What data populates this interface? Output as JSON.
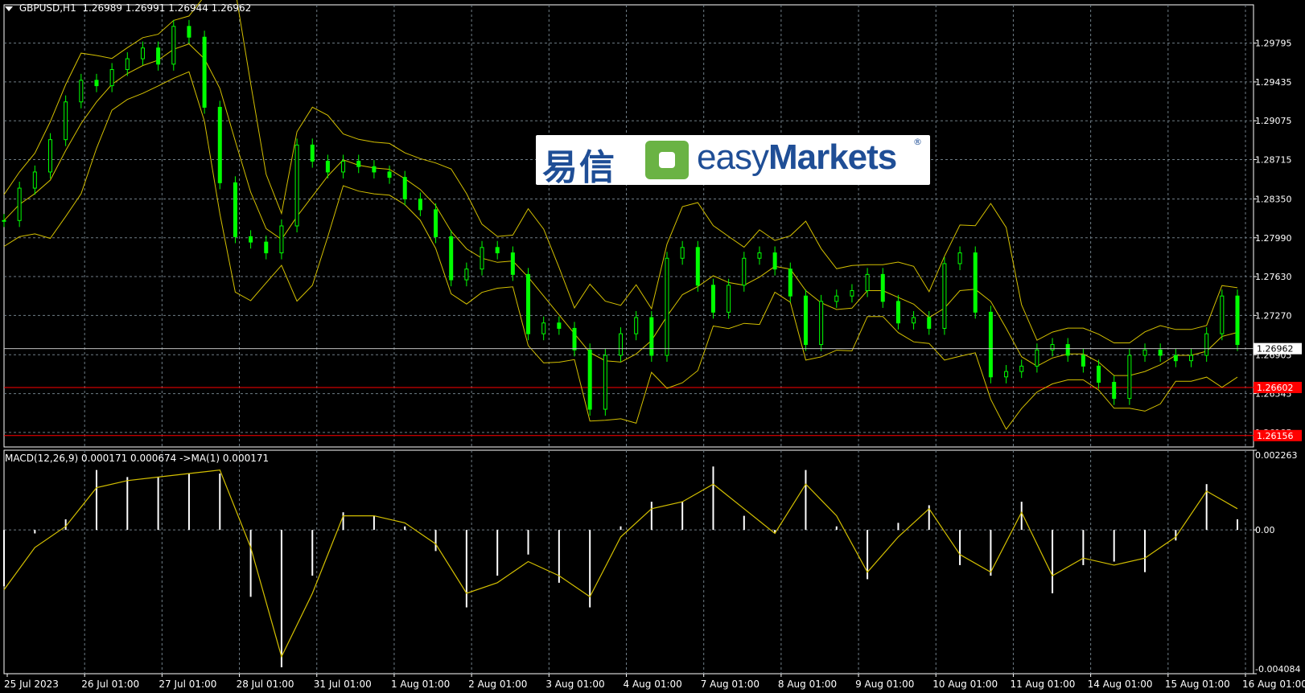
{
  "header": {
    "symbol": "GBPUSD,H1",
    "ohlc": "1.26989 1.26991 1.26944 1.26962",
    "macd_label": "MACD(12,26,9) 0.000171 0.000674  ->MA(1) 0.000171"
  },
  "logo": {
    "chinese": "易信",
    "brand_light": "easy",
    "brand_bold": "Markets",
    "reg": "®"
  },
  "colors": {
    "background": "#000000",
    "candles": "#00ff00",
    "bands": "#d4c000",
    "grid": "#6f7d86",
    "level": "#ff0000",
    "histogram": "#ffffff",
    "signal": "#d4c000"
  },
  "chart_data": [
    {
      "type": "line",
      "panel": "price",
      "instrument": "GBPUSD",
      "timeframe": "H1",
      "ylim": [
        1.2605,
        1.3015
      ],
      "yticks": [
        1.29795,
        1.29435,
        1.29075,
        1.28715,
        1.2835,
        1.2799,
        1.2763,
        1.2727,
        1.26905,
        1.26545,
        1.26185
      ],
      "ytick_labels": [
        "1.29795",
        "1.29435",
        "1.29075",
        "1.28715",
        "1.28350",
        "1.27990",
        "1.27630",
        "1.27270",
        "1.26905",
        "1.26545",
        "1.26185"
      ],
      "current_price": {
        "value": 1.26962,
        "label": "1.26962"
      },
      "levels": [
        {
          "value": 1.26602,
          "label": "1.26602",
          "color": "#ff0000"
        },
        {
          "value": 1.26156,
          "label": "1.26156",
          "color": "#ff0000"
        }
      ],
      "x_labels": [
        "25 Jul 2023",
        "26 Jul 01:00",
        "27 Jul 01:00",
        "28 Jul 01:00",
        "31 Jul 01:00",
        "1 Aug 01:00",
        "2 Aug 01:00",
        "3 Aug 01:00",
        "4 Aug 01:00",
        "7 Aug 01:00",
        "8 Aug 01:00",
        "9 Aug 01:00",
        "10 Aug 01:00",
        "11 Aug 01:00",
        "14 Aug 01:00",
        "15 Aug 01:00",
        "16 Aug 01:00"
      ],
      "x": [
        0,
        5,
        10,
        15,
        20,
        25,
        30,
        35,
        40,
        45,
        50,
        55,
        60,
        65,
        70,
        75,
        80,
        85,
        90,
        95,
        100,
        105,
        110,
        115,
        120,
        125,
        130,
        135,
        140,
        145,
        150,
        155,
        160,
        165,
        170,
        175,
        180,
        185,
        190,
        195,
        200,
        205,
        210,
        215,
        220,
        225,
        230,
        235,
        240,
        245,
        250,
        255,
        260,
        265,
        270,
        275,
        280,
        285,
        290,
        295,
        300,
        305,
        310,
        315,
        320,
        325,
        330,
        335,
        340,
        345,
        350,
        355,
        360,
        365,
        370,
        375,
        380,
        385,
        390,
        395,
        400
      ],
      "series": [
        {
          "values": [
            1.2815,
            1.2845,
            1.286,
            1.289,
            1.2925,
            1.2945,
            1.294,
            1.2955,
            1.2965,
            1.2975,
            1.296,
            1.2995,
            1.2985,
            1.292,
            1.285,
            1.28,
            1.2795,
            1.2785,
            1.281,
            1.2885,
            1.287,
            1.286,
            1.287,
            1.2865,
            1.286,
            1.2855,
            1.2835,
            1.2825,
            1.28,
            1.276,
            1.277,
            1.279,
            1.2785,
            1.2765,
            1.271,
            1.272,
            1.2715,
            1.2695,
            1.264,
            1.269,
            1.271,
            1.2725,
            1.269,
            1.278,
            1.279,
            1.2755,
            1.273,
            1.2755,
            1.278,
            1.2785,
            1.277,
            1.2745,
            1.27,
            1.274,
            1.2745,
            1.275,
            1.2765,
            1.274,
            1.272,
            1.2725,
            1.2715,
            1.2775,
            1.2785,
            1.273,
            1.267,
            1.2675,
            1.268,
            1.2695,
            1.27,
            1.269,
            1.268,
            1.2665,
            1.265,
            1.269,
            1.2695,
            1.269,
            1.2685,
            1.269,
            1.271,
            1.2745,
            1.27
          ]
        }
      ]
    },
    {
      "type": "bar",
      "panel": "macd",
      "ylim": [
        -0.004084,
        0.002263
      ],
      "yticks": [
        0.002263,
        0.0,
        -0.004084
      ],
      "ytick_labels": [
        "0.002263",
        "0.00",
        "-0.004084"
      ],
      "x": [
        0,
        10,
        20,
        30,
        40,
        50,
        60,
        70,
        80,
        90,
        100,
        110,
        120,
        130,
        140,
        150,
        160,
        170,
        180,
        190,
        200,
        210,
        220,
        230,
        240,
        250,
        260,
        270,
        280,
        290,
        300,
        310,
        320,
        330,
        340,
        350,
        360,
        370,
        380,
        390,
        400
      ],
      "series": [
        {
          "name": "MACD",
          "values": [
            -0.0016,
            -0.0001,
            0.0003,
            0.0017,
            0.0015,
            0.0015,
            0.0016,
            0.0016,
            -0.0019,
            -0.0039,
            -0.0013,
            0.0005,
            0.0004,
            0.0001,
            -0.0006,
            -0.0022,
            -0.0013,
            -0.0007,
            -0.0015,
            -0.0022,
            0.0001,
            0.0008,
            0.0008,
            0.0018,
            0.0004,
            -0.0001,
            0.0017,
            0.0001,
            -0.0014,
            0.0002,
            0.0007,
            -0.001,
            -0.0013,
            0.0008,
            -0.0018,
            -0.001,
            -0.0009,
            -0.0012,
            -0.0003,
            0.0013,
            0.0003
          ]
        },
        {
          "name": "Signal",
          "values": [
            -0.0017,
            -0.0005,
            0.0001,
            0.0012,
            0.0014,
            0.0015,
            0.0016,
            0.0017,
            -0.0005,
            -0.0036,
            -0.0018,
            0.0004,
            0.0004,
            0.0002,
            -0.0004,
            -0.0018,
            -0.0015,
            -0.0009,
            -0.0013,
            -0.0019,
            -0.0002,
            0.0006,
            0.0008,
            0.0013,
            0.0006,
            -0.0001,
            0.0013,
            0.0004,
            -0.0012,
            -0.0002,
            0.0006,
            -0.0007,
            -0.0012,
            0.0005,
            -0.0013,
            -0.0008,
            -0.001,
            -0.0008,
            -0.0002,
            0.0011,
            0.0006
          ]
        }
      ]
    }
  ]
}
